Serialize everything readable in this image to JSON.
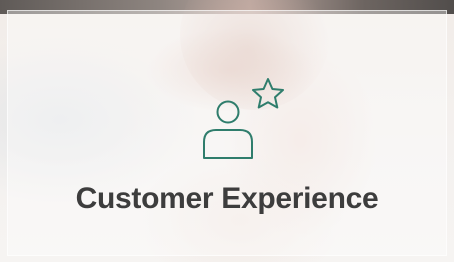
{
  "tile": {
    "title": "Customer Experience",
    "icon": "customer-star-icon",
    "icon_color": "#2f7d6c",
    "title_color": "#3d3d3d"
  }
}
